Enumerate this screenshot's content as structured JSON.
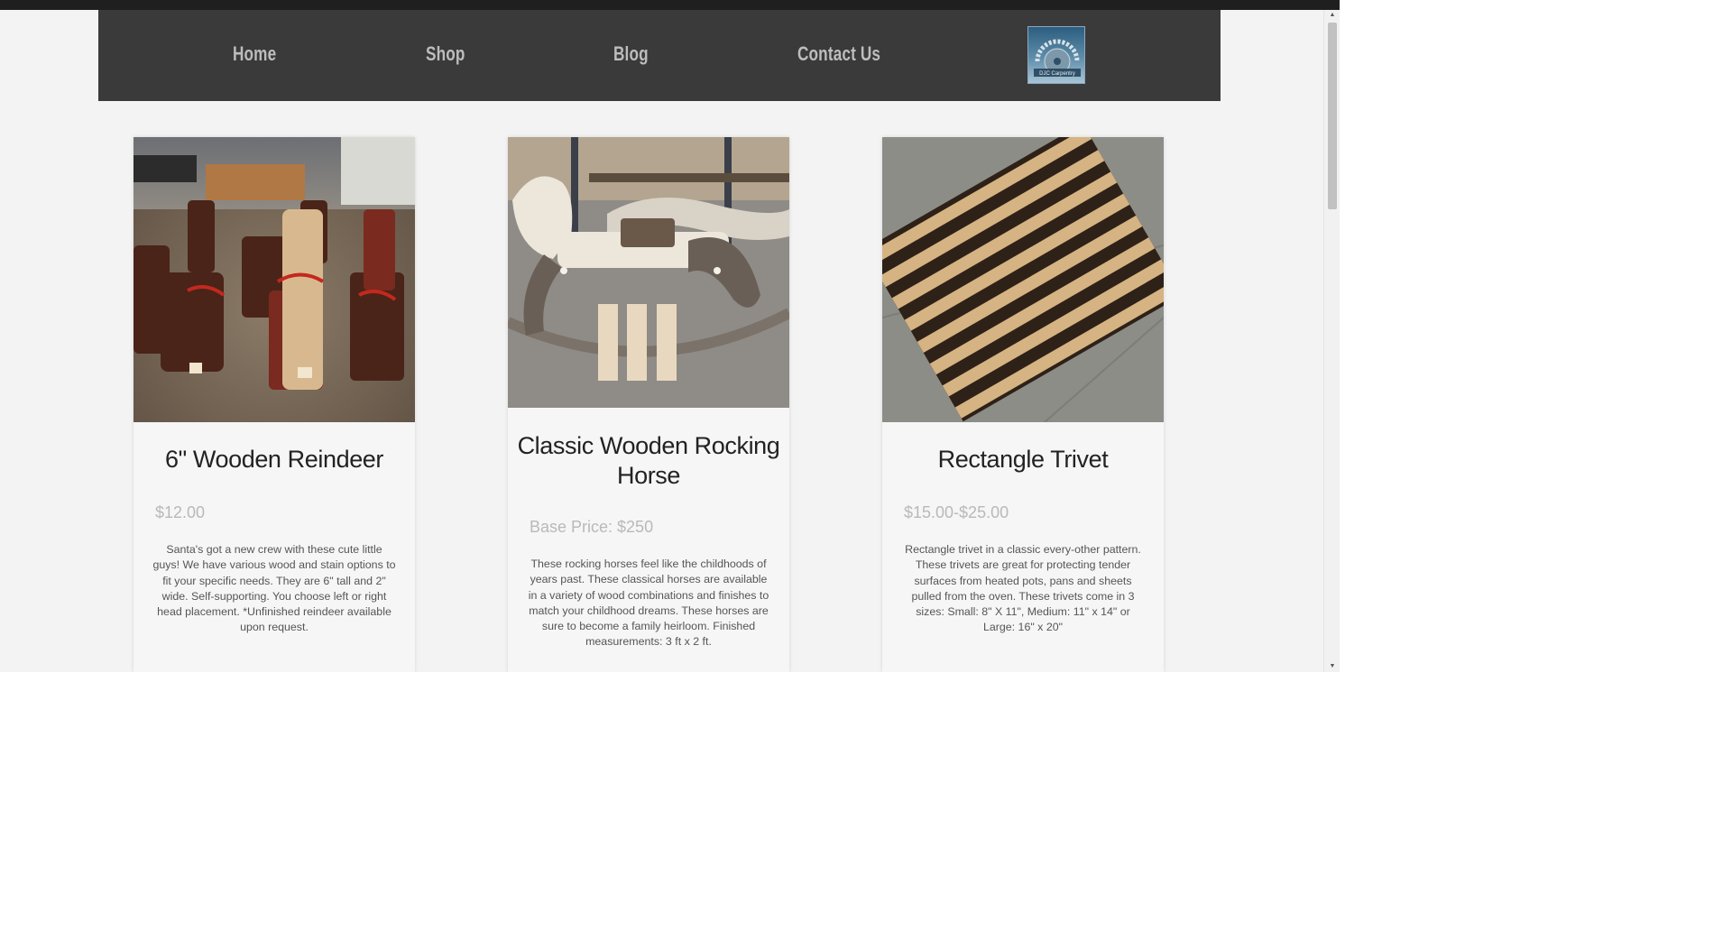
{
  "nav": {
    "links": [
      "Home",
      "Shop",
      "Blog",
      "Contact Us"
    ],
    "logo_text": "DJC Carpentry"
  },
  "products": [
    {
      "title": "6\" Wooden Reindeer",
      "price": "$12.00",
      "description": "Santa's got a new crew with these cute little guys! We have various wood and stain options to fit your specific needs. They are 6\" tall and 2\" wide. Self-supporting. You choose left or right head placement. *Unfinished reindeer available upon request."
    },
    {
      "title": "Classic Wooden Rocking Horse",
      "price": "Base Price: $250",
      "description": "These rocking horses feel like the childhoods of years past. These classical horses are available in a variety of wood combinations and finishes to match your childhood dreams. These horses are sure to become a family heirloom. Finished measurements: 3 ft x 2 ft."
    },
    {
      "title": "Rectangle Trivet",
      "price": "$15.00-$25.00",
      "description": "Rectangle trivet in a classic every-other pattern. These trivets are great for protecting tender surfaces from heated pots, pans and sheets pulled from the oven. These trivets come in 3 sizes: Small: 8\" X 11\", Medium: 11\" x 14\" or Large: 16\" x 20\""
    }
  ],
  "colors": {
    "navbar": "#3a3a3a",
    "nav_text": "#bdbdbd",
    "page_bg": "#f3f3f3"
  }
}
